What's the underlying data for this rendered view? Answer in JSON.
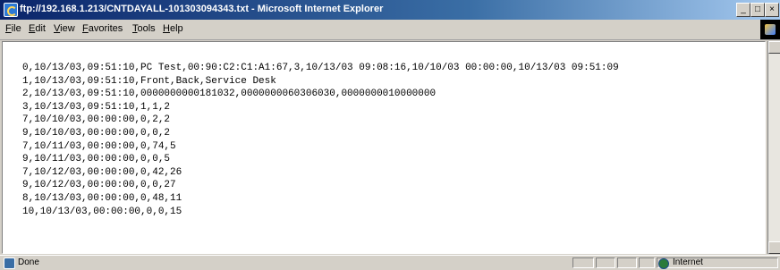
{
  "window": {
    "title": "ftp://192.168.1.213/CNTDAYALL-101303094343.txt - Microsoft Internet Explorer",
    "controls": {
      "minimize": "_",
      "maximize": "□",
      "close": "×"
    }
  },
  "menu": {
    "items": [
      "File",
      "Edit",
      "View",
      "Favorites",
      "Tools",
      "Help"
    ]
  },
  "document": {
    "lines": [
      "0,10/13/03,09:51:10,PC Test,00:90:C2:C1:A1:67,3,10/13/03 09:08:16,10/10/03 00:00:00,10/13/03 09:51:09",
      "1,10/13/03,09:51:10,Front,Back,Service Desk",
      "2,10/13/03,09:51:10,0000000000181032,0000000060306030,0000000010000000",
      "3,10/13/03,09:51:10,1,1,2",
      "7,10/10/03,00:00:00,0,2,2",
      "9,10/10/03,00:00:00,0,0,2",
      "7,10/11/03,00:00:00,0,74,5",
      "9,10/11/03,00:00:00,0,0,5",
      "7,10/12/03,00:00:00,0,42,26",
      "9,10/12/03,00:00:00,0,0,27",
      "8,10/13/03,00:00:00,0,48,11",
      "10,10/13/03,00:00:00,0,0,15"
    ]
  },
  "status": {
    "text": "Done",
    "zone": "Internet"
  },
  "icons": {
    "title": "ie-page-icon",
    "status": "page-icon",
    "zone": "globe-icon",
    "throbber": "windows-logo-icon"
  }
}
